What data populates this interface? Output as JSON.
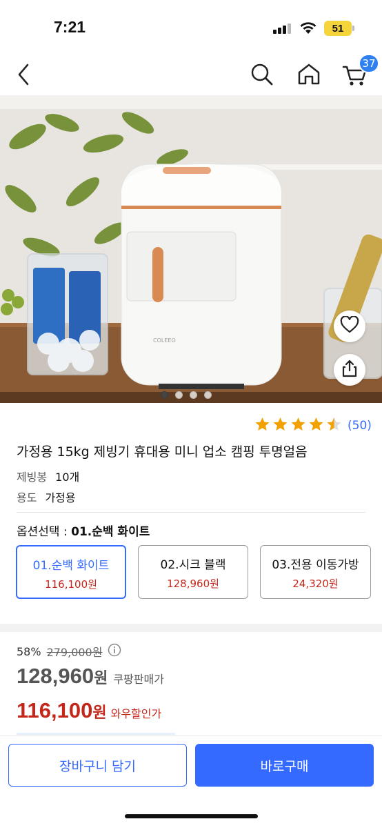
{
  "status": {
    "time": "7:21",
    "battery": "51"
  },
  "nav": {
    "cart_count": "37"
  },
  "product": {
    "rating_count": "(50)",
    "rating_value": 4.5,
    "title": "가정용 15kg 제빙기 휴대용 미니 업소 캠핑 투명얼음",
    "brand_text": "COLEEO",
    "specs": [
      {
        "key": "제빙봉",
        "value": "10개"
      },
      {
        "key": "용도",
        "value": "가정용"
      }
    ]
  },
  "options": {
    "label": "옵션선택 :",
    "selected": "01.순백 화이트",
    "items": [
      {
        "name": "01.순백 화이트",
        "price": "116,100원"
      },
      {
        "name": "02.시크 블랙",
        "price": "128,960원"
      },
      {
        "name": "03.전용 이동가방",
        "price": "24,320원"
      }
    ]
  },
  "pricing": {
    "discount_rate": "58%",
    "original_price": "279,000원",
    "coupang_price": "128,960",
    "coupang_unit": "원",
    "coupang_tag": "쿠팡판매가",
    "wow_price": "116,100",
    "wow_unit": "원",
    "wow_tag": "와우할인가"
  },
  "actions": {
    "cart_label": "장바구니 담기",
    "buy_label": "바로구매"
  },
  "colors": {
    "accent": "#346aff",
    "price_red": "#c4261a",
    "star": "#f2a100",
    "badge": "#2e7ff0"
  }
}
